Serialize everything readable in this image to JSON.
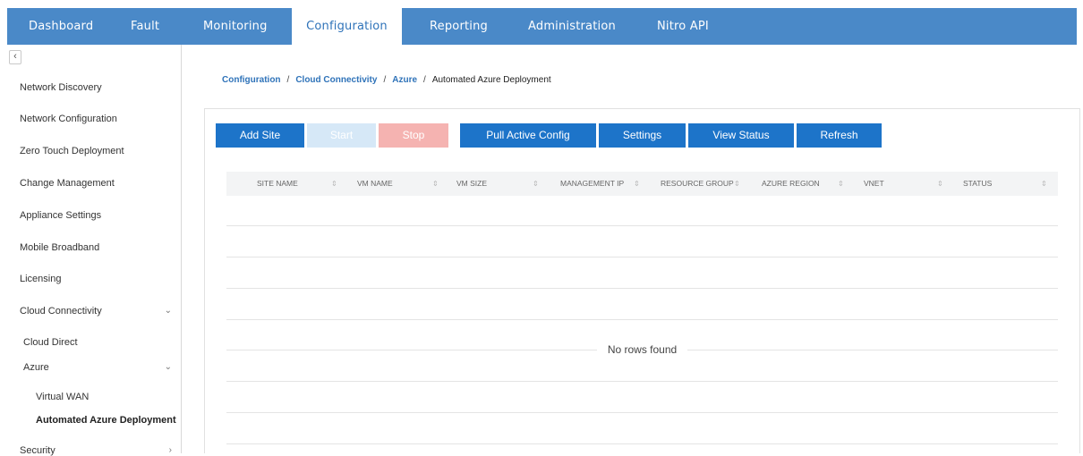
{
  "nav": {
    "tabs": [
      {
        "label": "Dashboard"
      },
      {
        "label": "Fault"
      },
      {
        "label": "Monitoring"
      },
      {
        "label": "Configuration"
      },
      {
        "label": "Reporting"
      },
      {
        "label": "Administration"
      },
      {
        "label": "Nitro API"
      }
    ],
    "active_tab": "Configuration",
    "bar_color": "#4a89c8"
  },
  "sidebar": {
    "collapse_icon": "chevron-left-icon",
    "items": [
      {
        "label": "Network Discovery"
      },
      {
        "label": "Network Configuration"
      },
      {
        "label": "Zero Touch Deployment"
      },
      {
        "label": "Change Management"
      },
      {
        "label": "Appliance Settings"
      },
      {
        "label": "Mobile Broadband"
      },
      {
        "label": "Licensing"
      },
      {
        "label": "Cloud Connectivity"
      },
      {
        "label": "Cloud Direct"
      },
      {
        "label": "Azure"
      },
      {
        "label": "Virtual WAN"
      },
      {
        "label": "Automated Azure Deployment"
      },
      {
        "label": "Security"
      }
    ],
    "selected": "Automated Azure Deployment"
  },
  "breadcrumb": {
    "items": [
      "Configuration",
      "Cloud Connectivity",
      "Azure"
    ],
    "current": "Automated Azure Deployment",
    "separator": "/"
  },
  "toolbar": {
    "add_site": "Add Site",
    "start": "Start",
    "stop": "Stop",
    "pull_active_config": "Pull Active Config",
    "settings": "Settings",
    "view_status": "View Status",
    "refresh": "Refresh",
    "primary_color": "#1d74c9"
  },
  "table": {
    "columns": [
      "SITE NAME",
      "VM NAME",
      "VM SIZE",
      "MANAGEMENT IP",
      "RESOURCE GROUP",
      "AZURE REGION",
      "VNET",
      "STATUS"
    ],
    "rows": [],
    "empty_message": "No rows found"
  }
}
